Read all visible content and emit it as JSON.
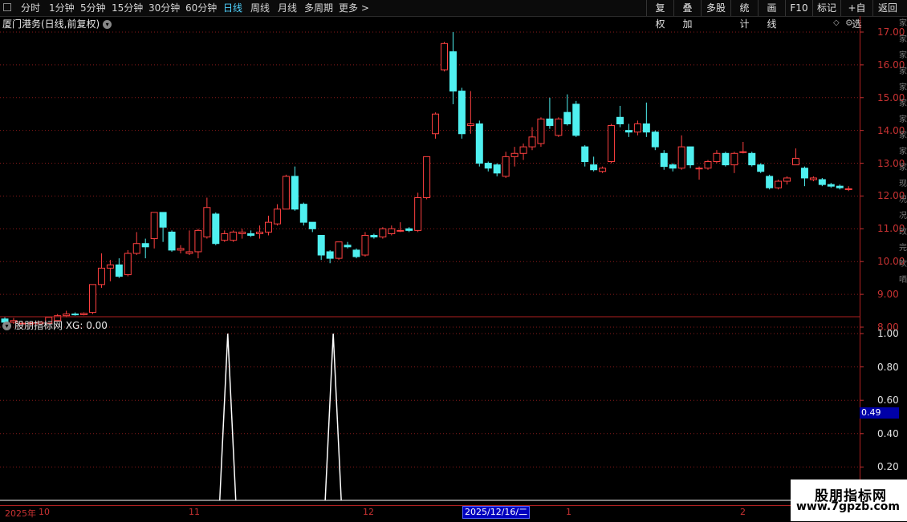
{
  "toolbar": {
    "periods": [
      "分时",
      "1分钟",
      "5分钟",
      "15分钟",
      "30分钟",
      "60分钟",
      "日线",
      "周线",
      "月线",
      "多周期",
      "更多 >"
    ],
    "active_period": "日线",
    "actions": [
      "复权",
      "叠加",
      "多股",
      "统计",
      "画线",
      "F10",
      "标记",
      "+自选",
      "返回"
    ]
  },
  "chart_title": "厦门港务(日线,前复权)",
  "indicator_title": "股朋指标网 XG: 0.00",
  "price_axis": [
    "17.00",
    "16.00",
    "15.00",
    "14.00",
    "13.00",
    "12.00",
    "11.00",
    "10.00",
    "9.00",
    "8.00"
  ],
  "indicator_axis": [
    "1.00",
    "0.80",
    "0.60",
    "0.40",
    "0.20"
  ],
  "current_value_tag": "0.49",
  "date_labels": [
    "2025年",
    "10",
    "11",
    "12",
    "1",
    "2"
  ],
  "highlight_date": "2025/12/16/二",
  "edge_strip_text": "家家家家家家家家家家现况况改完吹哂",
  "watermark": {
    "line1": "股朋指标网",
    "line2": "www.7gpzb.com"
  },
  "colors": {
    "up": "#ff4040",
    "down": "#4ff0f0",
    "grid": "#8a1a1a",
    "axis": "#c83232",
    "indicator_line": "#ffffff"
  },
  "chart_data": {
    "type": "candlestick",
    "ylim": [
      7.6,
      17.3
    ],
    "candles": [
      {
        "o": 8.25,
        "c": 8.15,
        "h": 8.3,
        "l": 8.1
      },
      {
        "o": 8.15,
        "c": 8.2,
        "h": 8.28,
        "l": 8.1
      },
      {
        "o": 8.12,
        "c": 8.12,
        "h": 8.18,
        "l": 8.08
      },
      {
        "o": 8.1,
        "c": 8.13,
        "h": 8.15,
        "l": 8.07
      },
      {
        "o": 8.1,
        "c": 8.15,
        "h": 8.18,
        "l": 8.08
      },
      {
        "o": 8.12,
        "c": 8.3,
        "h": 8.32,
        "l": 8.1
      },
      {
        "o": 8.2,
        "c": 8.35,
        "h": 8.4,
        "l": 8.18
      },
      {
        "o": 8.35,
        "c": 8.4,
        "h": 8.5,
        "l": 8.3
      },
      {
        "o": 8.4,
        "c": 8.38,
        "h": 8.45,
        "l": 8.35
      },
      {
        "o": 8.38,
        "c": 8.42,
        "h": 8.45,
        "l": 8.36
      },
      {
        "o": 8.45,
        "c": 9.3,
        "h": 9.3,
        "l": 8.4
      },
      {
        "o": 9.3,
        "c": 9.8,
        "h": 10.25,
        "l": 9.2
      },
      {
        "o": 9.8,
        "c": 9.9,
        "h": 10.05,
        "l": 9.4
      },
      {
        "o": 9.9,
        "c": 9.55,
        "h": 10.1,
        "l": 9.5
      },
      {
        "o": 9.6,
        "c": 10.25,
        "h": 10.35,
        "l": 9.55
      },
      {
        "o": 10.25,
        "c": 10.55,
        "h": 10.9,
        "l": 10.2
      },
      {
        "o": 10.55,
        "c": 10.45,
        "h": 10.7,
        "l": 10.1
      },
      {
        "o": 10.7,
        "c": 11.5,
        "h": 11.5,
        "l": 10.4
      },
      {
        "o": 11.5,
        "c": 11.05,
        "h": 11.5,
        "l": 10.6
      },
      {
        "o": 10.9,
        "c": 10.35,
        "h": 10.95,
        "l": 10.3
      },
      {
        "o": 10.35,
        "c": 10.4,
        "h": 10.5,
        "l": 10.25
      },
      {
        "o": 10.25,
        "c": 10.3,
        "h": 10.95,
        "l": 10.2
      },
      {
        "o": 10.3,
        "c": 10.95,
        "h": 11.0,
        "l": 10.1
      },
      {
        "o": 10.75,
        "c": 11.65,
        "h": 11.95,
        "l": 10.7
      },
      {
        "o": 11.45,
        "c": 10.55,
        "h": 11.5,
        "l": 10.5
      },
      {
        "o": 10.65,
        "c": 10.85,
        "h": 10.95,
        "l": 10.6
      },
      {
        "o": 10.65,
        "c": 10.9,
        "h": 10.95,
        "l": 10.6
      },
      {
        "o": 10.85,
        "c": 10.9,
        "h": 11.0,
        "l": 10.7
      },
      {
        "o": 10.85,
        "c": 10.8,
        "h": 10.95,
        "l": 10.75
      },
      {
        "o": 10.85,
        "c": 10.9,
        "h": 11.1,
        "l": 10.7
      },
      {
        "o": 10.9,
        "c": 11.2,
        "h": 11.4,
        "l": 10.8
      },
      {
        "o": 11.15,
        "c": 11.6,
        "h": 11.75,
        "l": 11.1
      },
      {
        "o": 11.6,
        "c": 12.6,
        "h": 12.65,
        "l": 11.6
      },
      {
        "o": 12.6,
        "c": 11.6,
        "h": 12.9,
        "l": 11.55
      },
      {
        "o": 11.75,
        "c": 11.2,
        "h": 11.8,
        "l": 11.1
      },
      {
        "o": 11.2,
        "c": 11.0,
        "h": 11.2,
        "l": 10.9
      },
      {
        "o": 10.8,
        "c": 10.2,
        "h": 10.8,
        "l": 10.05
      },
      {
        "o": 10.3,
        "c": 10.1,
        "h": 10.35,
        "l": 9.95
      },
      {
        "o": 10.1,
        "c": 10.6,
        "h": 10.6,
        "l": 10.05
      },
      {
        "o": 10.5,
        "c": 10.45,
        "h": 10.6,
        "l": 10.4
      },
      {
        "o": 10.35,
        "c": 10.15,
        "h": 10.4,
        "l": 10.1
      },
      {
        "o": 10.2,
        "c": 10.8,
        "h": 10.9,
        "l": 10.15
      },
      {
        "o": 10.8,
        "c": 10.75,
        "h": 10.85,
        "l": 10.7
      },
      {
        "o": 10.75,
        "c": 11.0,
        "h": 11.05,
        "l": 10.7
      },
      {
        "o": 10.85,
        "c": 11.0,
        "h": 11.1,
        "l": 10.8
      },
      {
        "o": 10.95,
        "c": 10.95,
        "h": 11.2,
        "l": 10.9
      },
      {
        "o": 11.0,
        "c": 10.95,
        "h": 11.05,
        "l": 10.9
      },
      {
        "o": 10.95,
        "c": 11.95,
        "h": 12.1,
        "l": 10.9
      },
      {
        "o": 11.95,
        "c": 13.2,
        "h": 13.2,
        "l": 11.9
      },
      {
        "o": 13.9,
        "c": 14.5,
        "h": 14.55,
        "l": 13.75
      },
      {
        "o": 15.85,
        "c": 16.65,
        "h": 16.7,
        "l": 15.8
      },
      {
        "o": 16.4,
        "c": 15.2,
        "h": 17.0,
        "l": 14.8
      },
      {
        "o": 15.2,
        "c": 13.9,
        "h": 15.3,
        "l": 13.75
      },
      {
        "o": 14.15,
        "c": 14.2,
        "h": 15.2,
        "l": 13.9
      },
      {
        "o": 14.2,
        "c": 13.0,
        "h": 14.3,
        "l": 12.9
      },
      {
        "o": 13.0,
        "c": 12.85,
        "h": 13.05,
        "l": 12.75
      },
      {
        "o": 12.95,
        "c": 12.7,
        "h": 13.0,
        "l": 12.6
      },
      {
        "o": 12.6,
        "c": 13.2,
        "h": 13.35,
        "l": 12.55
      },
      {
        "o": 13.2,
        "c": 13.3,
        "h": 13.5,
        "l": 12.9
      },
      {
        "o": 13.3,
        "c": 13.5,
        "h": 13.6,
        "l": 13.1
      },
      {
        "o": 13.5,
        "c": 13.8,
        "h": 14.1,
        "l": 13.4
      },
      {
        "o": 13.6,
        "c": 14.35,
        "h": 14.4,
        "l": 13.5
      },
      {
        "o": 14.35,
        "c": 14.15,
        "h": 15.0,
        "l": 14.05
      },
      {
        "o": 13.85,
        "c": 14.35,
        "h": 14.4,
        "l": 13.8
      },
      {
        "o": 14.55,
        "c": 14.2,
        "h": 15.1,
        "l": 14.15
      },
      {
        "o": 14.8,
        "c": 13.85,
        "h": 14.9,
        "l": 13.8
      },
      {
        "o": 13.5,
        "c": 13.05,
        "h": 13.55,
        "l": 12.9
      },
      {
        "o": 12.95,
        "c": 12.8,
        "h": 13.2,
        "l": 12.75
      },
      {
        "o": 12.75,
        "c": 12.85,
        "h": 12.9,
        "l": 12.7
      },
      {
        "o": 13.05,
        "c": 14.15,
        "h": 14.2,
        "l": 13.0
      },
      {
        "o": 14.4,
        "c": 14.2,
        "h": 14.75,
        "l": 14.1
      },
      {
        "o": 14.0,
        "c": 13.95,
        "h": 14.2,
        "l": 13.8
      },
      {
        "o": 13.95,
        "c": 14.2,
        "h": 14.3,
        "l": 13.85
      },
      {
        "o": 14.2,
        "c": 13.95,
        "h": 14.85,
        "l": 13.8
      },
      {
        "o": 13.95,
        "c": 13.5,
        "h": 14.0,
        "l": 13.4
      },
      {
        "o": 13.3,
        "c": 12.9,
        "h": 13.4,
        "l": 12.8
      },
      {
        "o": 12.95,
        "c": 12.85,
        "h": 13.0,
        "l": 12.75
      },
      {
        "o": 12.85,
        "c": 13.5,
        "h": 13.85,
        "l": 12.8
      },
      {
        "o": 13.5,
        "c": 12.95,
        "h": 13.5,
        "l": 12.85
      },
      {
        "o": 12.85,
        "c": 12.85,
        "h": 12.9,
        "l": 12.5
      },
      {
        "o": 12.85,
        "c": 13.05,
        "h": 13.1,
        "l": 12.8
      },
      {
        "o": 13.05,
        "c": 13.3,
        "h": 13.4,
        "l": 13.0
      },
      {
        "o": 13.3,
        "c": 12.95,
        "h": 13.35,
        "l": 12.9
      },
      {
        "o": 12.95,
        "c": 13.3,
        "h": 13.35,
        "l": 12.7
      },
      {
        "o": 13.35,
        "c": 13.35,
        "h": 13.65,
        "l": 13.3
      },
      {
        "o": 13.3,
        "c": 12.95,
        "h": 13.35,
        "l": 12.9
      },
      {
        "o": 12.95,
        "c": 12.75,
        "h": 13.0,
        "l": 12.7
      },
      {
        "o": 12.6,
        "c": 12.25,
        "h": 12.65,
        "l": 12.2
      },
      {
        "o": 12.25,
        "c": 12.45,
        "h": 12.5,
        "l": 12.2
      },
      {
        "o": 12.45,
        "c": 12.55,
        "h": 12.6,
        "l": 12.35
      },
      {
        "o": 12.95,
        "c": 13.15,
        "h": 13.45,
        "l": 12.95
      },
      {
        "o": 12.85,
        "c": 12.55,
        "h": 12.9,
        "l": 12.3
      },
      {
        "o": 12.5,
        "c": 12.55,
        "h": 12.6,
        "l": 12.45
      },
      {
        "o": 12.5,
        "c": 12.35,
        "h": 12.55,
        "l": 12.3
      },
      {
        "o": 12.35,
        "c": 12.3,
        "h": 12.4,
        "l": 12.25
      },
      {
        "o": 12.3,
        "c": 12.25,
        "h": 12.35,
        "l": 12.2
      },
      {
        "o": 12.2,
        "c": 12.22,
        "h": 12.3,
        "l": 12.15
      }
    ],
    "indicator": {
      "name": "XG",
      "ylim": [
        0,
        1.05
      ],
      "spikes_at_candle_index": [
        25,
        37
      ],
      "values_note_free": [
        0,
        1
      ]
    }
  }
}
